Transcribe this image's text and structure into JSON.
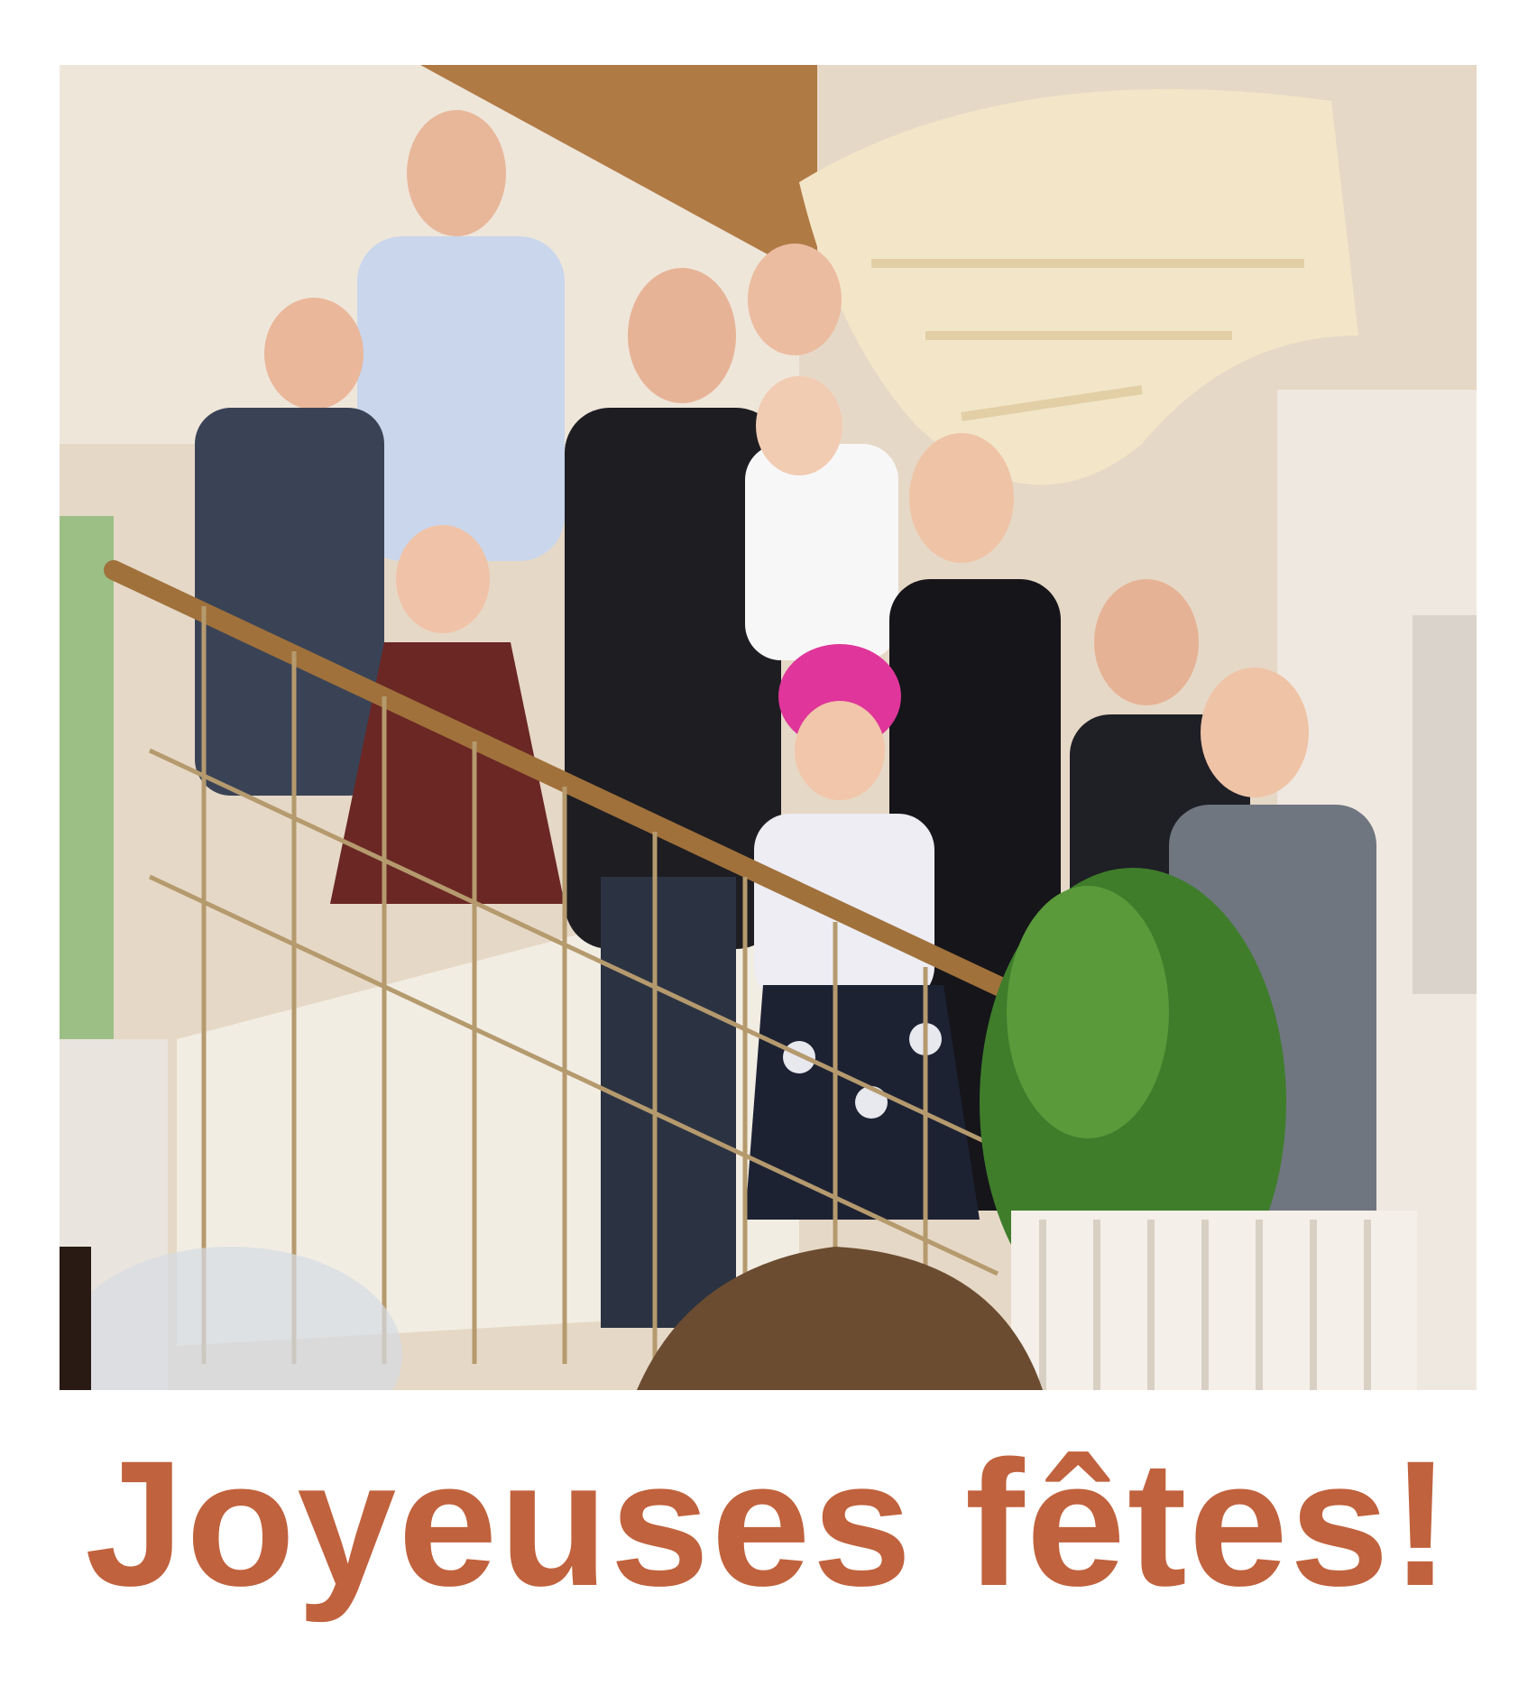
{
  "card": {
    "greeting": "Joyeuses fêtes!",
    "greeting_color": "#c0623d",
    "background_color": "#ffffff"
  },
  "photo": {
    "people_count": 11
  }
}
